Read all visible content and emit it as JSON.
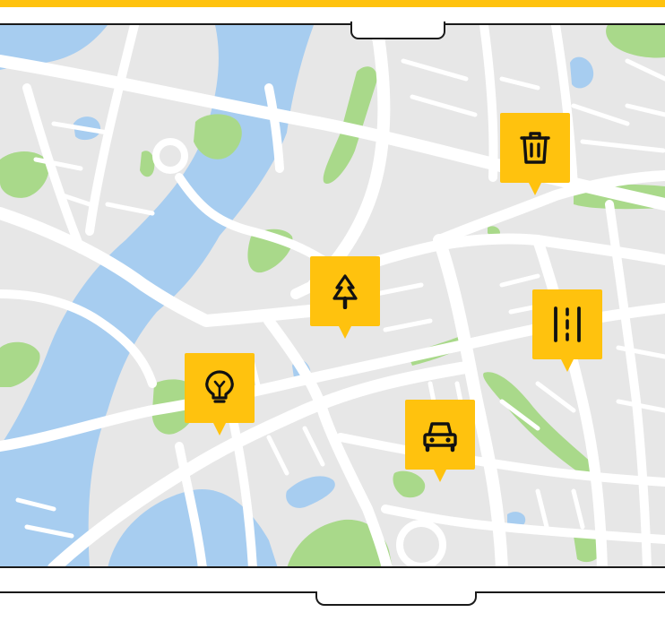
{
  "map": {
    "colors": {
      "land": "#e7e7e7",
      "road": "#ffffff",
      "water": "#a7cdf0",
      "park": "#a9d98a",
      "frame": "#1a1a1a",
      "accent": "#FFC20E"
    },
    "pins": [
      {
        "id": "trash",
        "icon": "trash-can-icon",
        "label": ""
      },
      {
        "id": "tree",
        "icon": "tree-icon",
        "label": ""
      },
      {
        "id": "road",
        "icon": "road-lanes-icon",
        "label": ""
      },
      {
        "id": "bulb",
        "icon": "light-bulb-icon",
        "label": ""
      },
      {
        "id": "car",
        "icon": "car-icon",
        "label": ""
      }
    ]
  }
}
